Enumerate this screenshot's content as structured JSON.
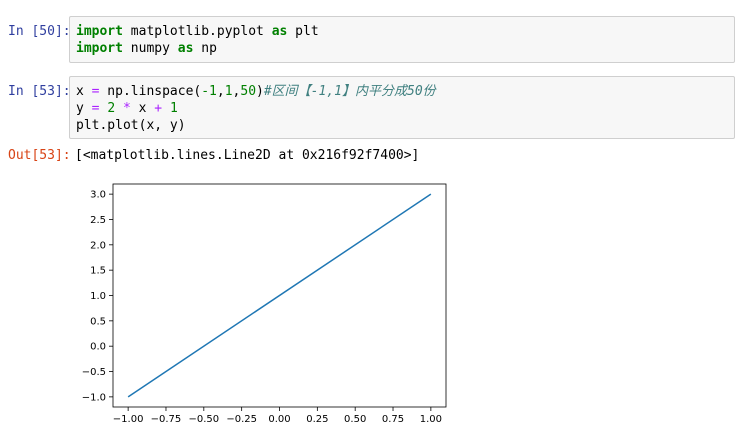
{
  "cells": {
    "cell1": {
      "prompt": "In [50]:",
      "line1": {
        "kw1": "import",
        "mid": " matplotlib.pyplot ",
        "kw2": "as",
        "tail": " plt"
      },
      "line2": {
        "kw1": "import",
        "mid": " numpy ",
        "kw2": "as",
        "tail": " np"
      }
    },
    "cell2": {
      "prompt": "In [53]:",
      "line1": {
        "a": "x ",
        "eq": "=",
        "b": " np.linspace(",
        "n1": "-1",
        "c1": ",",
        "n2": "1",
        "c2": ",",
        "n3": "50",
        "c3": ")",
        "comment": "#区间【-1,1】内平分成50份"
      },
      "line2": {
        "a": "y ",
        "eq": "=",
        "b": " ",
        "n1": "2",
        "c": " ",
        "mul": "*",
        "d": " x ",
        "plus": "+",
        "e": " ",
        "n2": "1"
      },
      "line3": {
        "a": "plt.plot(x, y)"
      }
    },
    "output": {
      "prompt": "Out[53]:",
      "text": "[<matplotlib.lines.Line2D at 0x216f92f7400>]"
    }
  },
  "chart_data": {
    "type": "line",
    "x": [
      -1.0,
      1.0
    ],
    "y": [
      -1.0,
      3.0
    ],
    "series": [
      {
        "x": [
          -1.0,
          1.0
        ],
        "y": [
          -1.0,
          3.0
        ],
        "color": "#1f77b4"
      }
    ],
    "xlim": [
      -1.1,
      1.1
    ],
    "ylim": [
      -1.2,
      3.2
    ],
    "xticks": [
      -1.0,
      -0.75,
      -0.5,
      -0.25,
      0.0,
      0.25,
      0.5,
      0.75,
      1.0
    ],
    "xtick_labels": [
      "−1.00",
      "−0.75",
      "−0.50",
      "−0.25",
      "0.00",
      "0.25",
      "0.50",
      "0.75",
      "1.00"
    ],
    "yticks": [
      -1.0,
      -0.5,
      0.0,
      0.5,
      1.0,
      1.5,
      2.0,
      2.5,
      3.0
    ],
    "ytick_labels": [
      "−1.0",
      "−0.5",
      "0.0",
      "0.5",
      "1.0",
      "1.5",
      "2.0",
      "2.5",
      "3.0"
    ],
    "grid": false,
    "title": "",
    "xlabel": "",
    "ylabel": ""
  }
}
